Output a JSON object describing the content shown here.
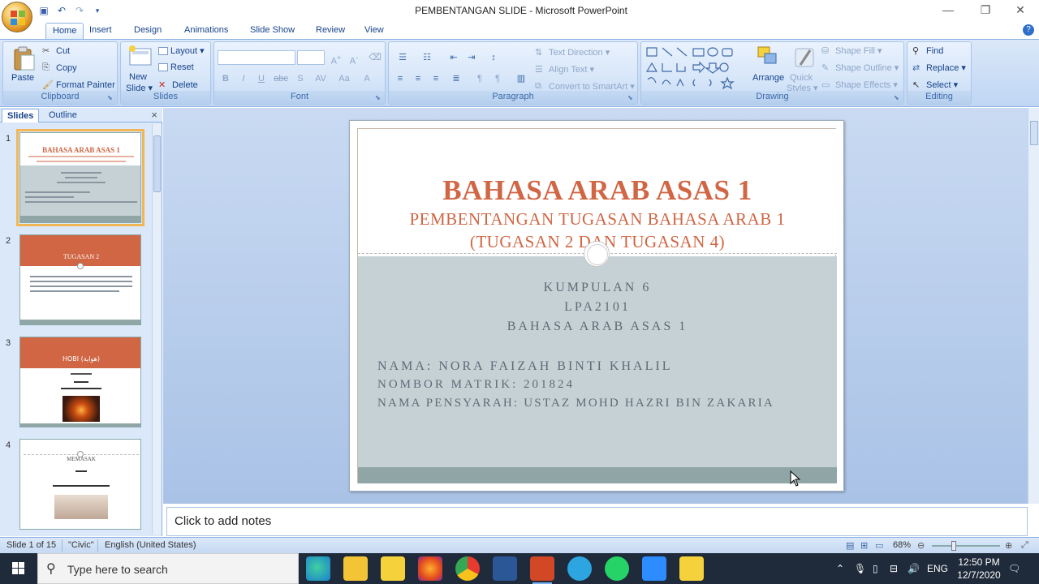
{
  "window": {
    "title": "PEMBENTANGAN SLIDE - Microsoft PowerPoint",
    "minimize": "—",
    "maximize": "❐",
    "close": "✕"
  },
  "tabs": [
    "Home",
    "Insert",
    "Design",
    "Animations",
    "Slide Show",
    "Review",
    "View"
  ],
  "ribbon": {
    "clipboard": {
      "label": "Clipboard",
      "paste": "Paste",
      "cut": "Cut",
      "copy": "Copy",
      "format_painter": "Format Painter"
    },
    "slides": {
      "label": "Slides",
      "new_slide": "New",
      "new_slide2": "Slide ▾",
      "layout": "Layout ▾",
      "reset": "Reset",
      "delete": "Delete"
    },
    "font": {
      "label": "Font",
      "bold": "B",
      "italic": "I",
      "underline": "U",
      "strike": "abc",
      "shadow": "S",
      "spacing": "AV",
      "case": "Aa",
      "color": "A"
    },
    "paragraph": {
      "label": "Paragraph",
      "text_direction": "Text Direction ▾",
      "align_text": "Align Text ▾",
      "convert_smartart": "Convert to SmartArt ▾"
    },
    "drawing": {
      "label": "Drawing",
      "arrange": "Arrange",
      "quick_styles": "Quick",
      "quick_styles2": "Styles ▾",
      "shape_fill": "Shape Fill ▾",
      "shape_outline": "Shape Outline ▾",
      "shape_effects": "Shape Effects ▾"
    },
    "editing": {
      "label": "Editing",
      "find": "Find",
      "replace": "Replace ▾",
      "select": "Select ▾"
    }
  },
  "left_panel": {
    "tab_slides": "Slides",
    "tab_outline": "Outline",
    "close": "×",
    "thumbnails": [
      {
        "num": "1",
        "title": "BAHASA ARAB ASAS 1"
      },
      {
        "num": "2",
        "title": "TUGASAN 2"
      },
      {
        "num": "3",
        "title": "HOBI (هواية)"
      },
      {
        "num": "4",
        "title": "MEMASAK"
      }
    ]
  },
  "slide": {
    "title": "BAHASA ARAB ASAS 1",
    "subtitle_line1": "PEMBENTANGAN TUGASAN BAHASA ARAB 1",
    "subtitle_line2": "(TUGASAN 2 DAN TUGASAN 4)",
    "group": "KUMPULAN 6",
    "code": "LPA2101",
    "course": "BAHASA ARAB ASAS 1",
    "name": "NAMA: NORA FAIZAH BINTI KHALIL",
    "matric": "NOMBOR MATRIK: 201824",
    "lecturer": "NAMA PENSYARAH: USTAZ MOHD HAZRI BIN ZAKARIA"
  },
  "notes_placeholder": "Click to add notes",
  "status": {
    "slide_info": "Slide 1 of 15",
    "theme": "\"Civic\"",
    "language": "English (United States)",
    "zoom": "68%"
  },
  "taskbar": {
    "search_placeholder": "Type here to search",
    "lang": "ENG",
    "time": "12:50 PM",
    "date": "12/7/2020"
  }
}
